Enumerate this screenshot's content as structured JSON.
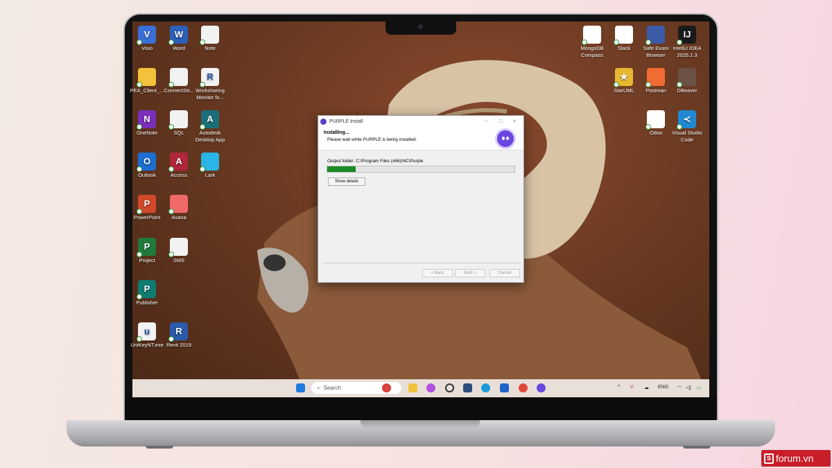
{
  "desktop": {
    "left_icons": [
      {
        "label": "Visio",
        "color": "#3a6fd8",
        "glyph": "V"
      },
      {
        "label": "Word",
        "color": "#2b5fb8",
        "glyph": "W"
      },
      {
        "label": "Note",
        "color": "#f2f2f2",
        "glyph": ""
      },
      {
        "label": "PEA_Client_...",
        "color": "#f2c23a",
        "glyph": ""
      },
      {
        "label": "ConnectStr...",
        "color": "#f2f2f2",
        "glyph": ""
      },
      {
        "label": "Worksharing Monitor fo...",
        "color": "#f2f2f2",
        "glyph": "R"
      },
      {
        "label": "OneNote",
        "color": "#7b2fb8",
        "glyph": "N"
      },
      {
        "label": "SQL",
        "color": "#f2f2f2",
        "glyph": ""
      },
      {
        "label": "Autodesk Desktop App",
        "color": "#1b6f7a",
        "glyph": "A"
      },
      {
        "label": "Outlook",
        "color": "#1a6fd0",
        "glyph": "O"
      },
      {
        "label": "Access",
        "color": "#b0263a",
        "glyph": "A"
      },
      {
        "label": "Lark",
        "color": "#2bb5e6",
        "glyph": ""
      },
      {
        "label": "PowerPoint",
        "color": "#d2492a",
        "glyph": "P"
      },
      {
        "label": "Asana",
        "color": "#f06a6a",
        "glyph": ""
      },
      {
        "label": "Project",
        "color": "#1f7a3c",
        "glyph": "P"
      },
      {
        "label": "SMS",
        "color": "#f2f2f2",
        "glyph": ""
      },
      {
        "label": "Publisher",
        "color": "#0f7c72",
        "glyph": "P"
      },
      {
        "label": "UniKeyNT.exe",
        "color": "#f2f2f2",
        "glyph": "u"
      },
      {
        "label": "Revit 2019",
        "color": "#2a5aa8",
        "glyph": "R"
      }
    ],
    "right_icons": [
      {
        "label": "MongoDB Compass",
        "color": "#ffffff",
        "glyph": ""
      },
      {
        "label": "Slack",
        "color": "#ffffff",
        "glyph": ""
      },
      {
        "label": "Safe Exam Browser",
        "color": "#3b5ba8",
        "glyph": ""
      },
      {
        "label": "IntelliJ IDEA 2025.1.3",
        "color": "#1a1a1a",
        "glyph": "IJ"
      },
      {
        "label": "StarUML",
        "color": "#e8b830",
        "glyph": "★"
      },
      {
        "label": "Postman",
        "color": "#ef6c32",
        "glyph": ""
      },
      {
        "label": "DBeaver",
        "color": "#6b5244",
        "glyph": ""
      },
      {
        "label": "Odoo",
        "color": "#ffffff",
        "glyph": ""
      },
      {
        "label": "Visual Studio Code",
        "color": "#1f8ad2",
        "glyph": "≺"
      }
    ]
  },
  "installer": {
    "window_title": "PURPLE Install",
    "header_title": "Installing...",
    "header_subtitle": "Please wait while PURPLE is being installed.",
    "output_folder": "Output folder: C:\\Program Files (x86)\\NC\\Purple",
    "progress_fraction": 0.15,
    "show_details": "Show details",
    "back": "< Back",
    "next": "Next >",
    "cancel": "Cancel"
  },
  "taskbar": {
    "search_placeholder": "Search",
    "language": "ENG"
  },
  "watermark": {
    "text": "forum.vn",
    "logo": "S"
  }
}
